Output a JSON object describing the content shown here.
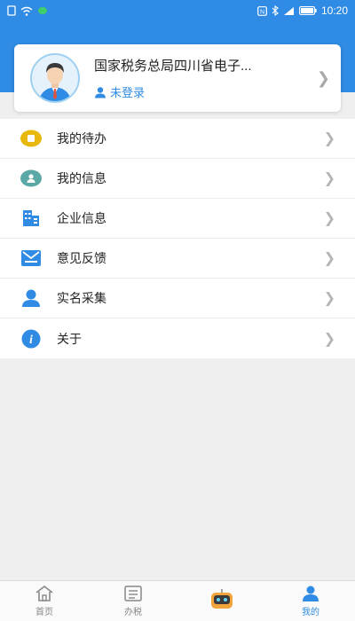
{
  "status_bar": {
    "time": "10:20",
    "left_icons": [
      "sim-icon",
      "wifi-icon",
      "wechat-icon"
    ],
    "right_icons": [
      "nfc-icon",
      "bluetooth-icon",
      "signal-icon",
      "battery-icon"
    ]
  },
  "profile": {
    "org_name": "国家税务总局四川省电子...",
    "login_status": "未登录"
  },
  "menu": {
    "items": [
      {
        "label": "我的待办",
        "icon": "todo-icon",
        "color": "#e8b80e"
      },
      {
        "label": "我的信息",
        "icon": "user-info-icon",
        "color": "#5aa9a6"
      },
      {
        "label": "企业信息",
        "icon": "building-icon",
        "color": "#2f8be3"
      },
      {
        "label": "意见反馈",
        "icon": "feedback-icon",
        "color": "#2f8be3"
      },
      {
        "label": "实名采集",
        "icon": "person-icon",
        "color": "#2f8be3"
      },
      {
        "label": "关于",
        "icon": "info-icon",
        "color": "#2f8be3"
      }
    ]
  },
  "tabbar": {
    "tabs": [
      {
        "label": "首页",
        "icon": "home-icon",
        "active": false
      },
      {
        "label": "办税",
        "icon": "tax-list-icon",
        "active": false
      },
      {
        "label": "",
        "icon": "robot-icon",
        "active": false
      },
      {
        "label": "我的",
        "icon": "profile-icon",
        "active": true
      }
    ]
  },
  "colors": {
    "primary": "#2f8be3",
    "background": "#efefef"
  }
}
